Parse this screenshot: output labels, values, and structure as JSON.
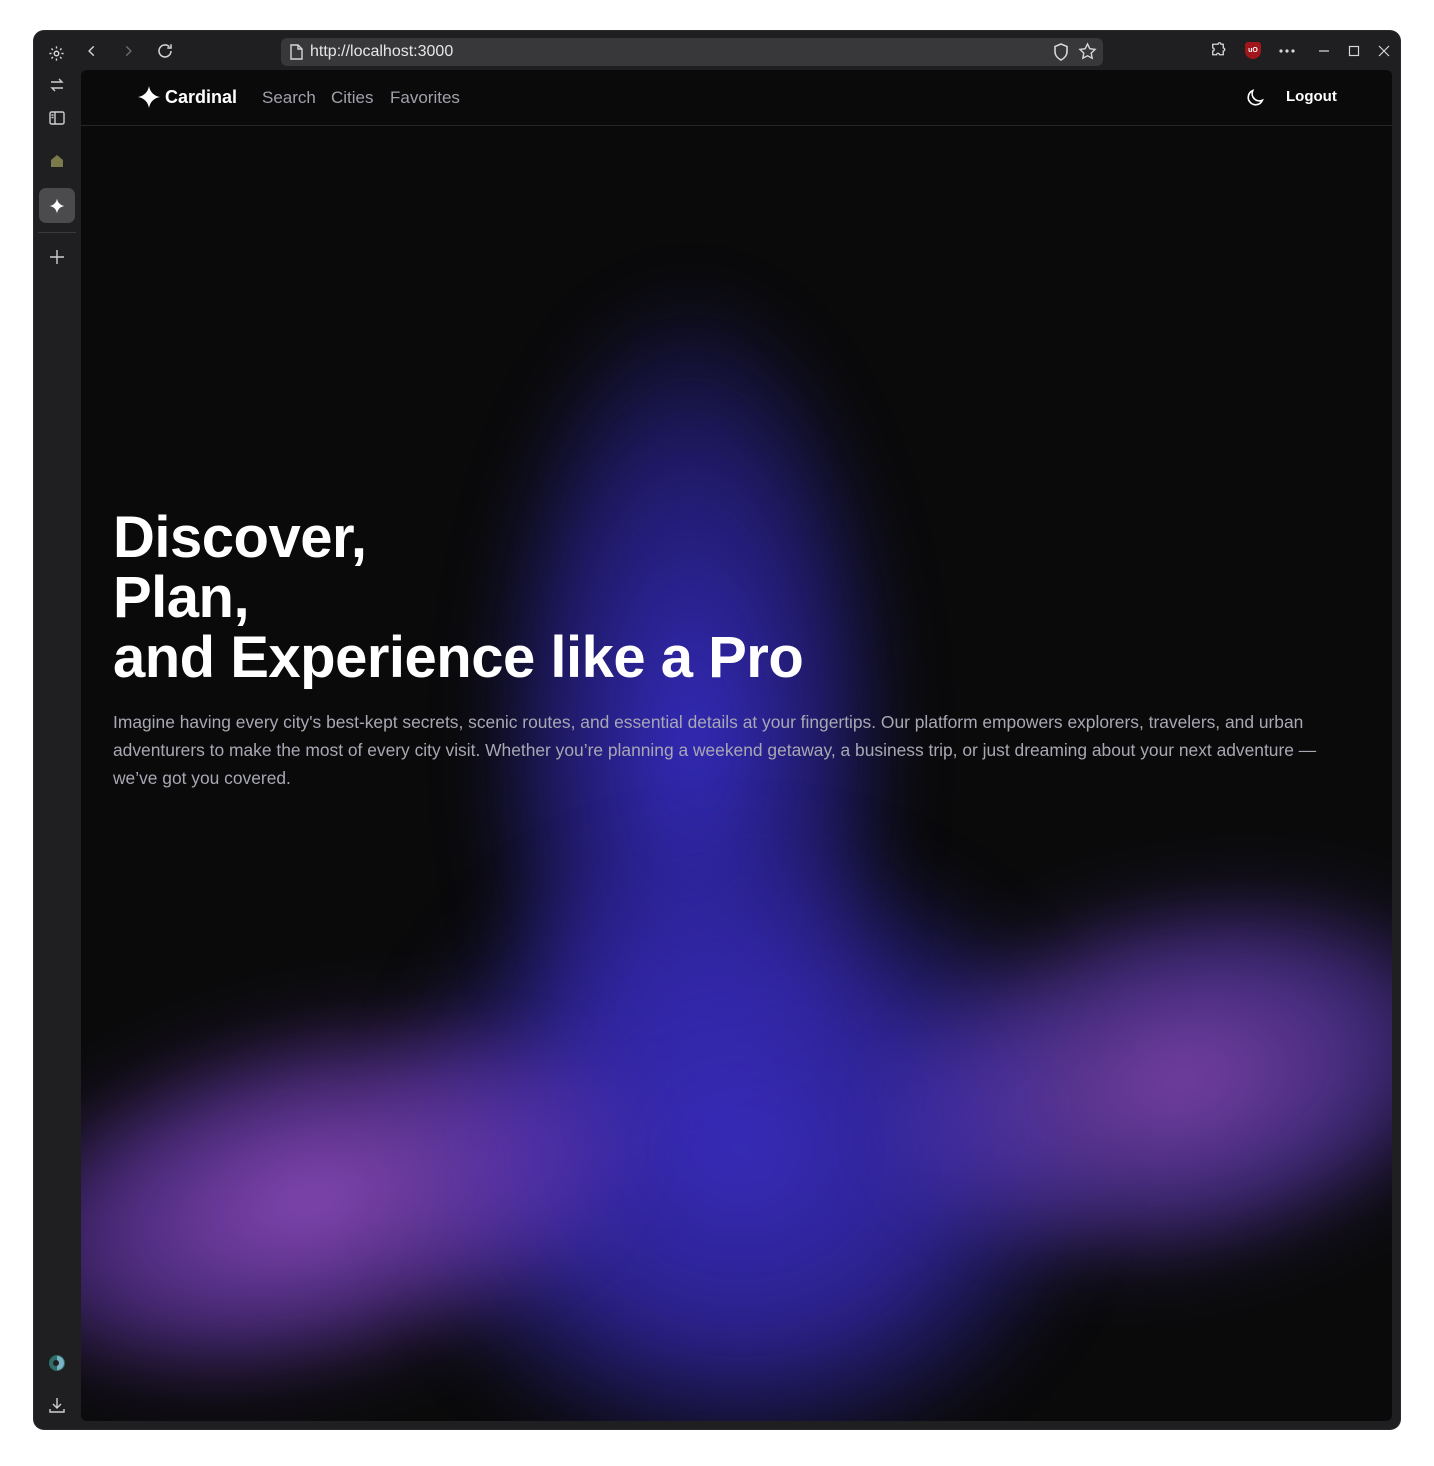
{
  "browser": {
    "url": "http://localhost:3000",
    "icons": {
      "settings": "gear-icon",
      "back": "back-arrow-icon",
      "forward": "forward-arrow-icon",
      "reload": "reload-icon",
      "page": "page-icon",
      "shield": "shield-icon",
      "bookmark": "star-icon",
      "extensions": "puzzle-icon",
      "ublock": "ublock-icon",
      "menu": "more-icon",
      "minimize": "minimize-icon",
      "maximize": "maximize-icon",
      "close": "close-icon"
    },
    "ublock_label": "uO"
  },
  "sidebar": {
    "icons": [
      "switch-icon",
      "sidebar-toggle-icon",
      "house-icon",
      "sparkle-tab-icon",
      "plus-icon",
      "avatar-icon",
      "download-icon"
    ]
  },
  "nav": {
    "brand": "Cardinal",
    "links": [
      "Search",
      "Cities",
      "Favorites"
    ],
    "logout": "Logout"
  },
  "hero": {
    "title_lines": [
      "Discover,",
      "Plan,",
      "and Experience like a Pro"
    ],
    "description": "Imagine having every city's best-kept secrets, scenic routes, and essential details at your fingertips. Our platform empowers explorers, travelers, and urban adventurers to make the most of every city visit. Whether you’re planning a weekend getaway, a business trip, or just dreaming about your next adventure — we’ve got you covered."
  },
  "colors": {
    "page_bg": "#0a0a0b",
    "glow_blue": "#3a2dc5",
    "glow_purple": "#9650c8",
    "nav_link": "#a1a1aa",
    "description": "#a8a8b3"
  }
}
